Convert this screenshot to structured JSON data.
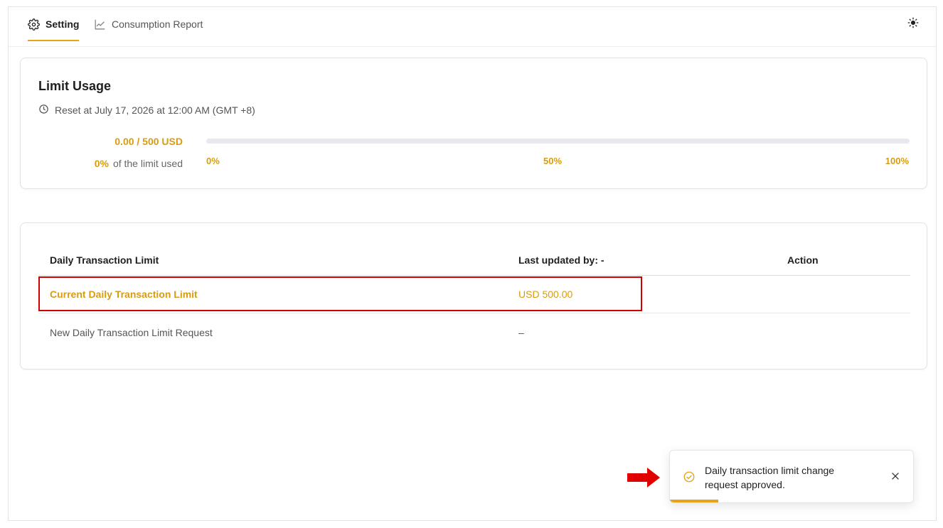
{
  "tabs": [
    {
      "label": "Setting",
      "icon": "gear-icon",
      "active": true
    },
    {
      "label": "Consumption Report",
      "icon": "line-chart-icon",
      "active": false
    }
  ],
  "header": {
    "theme_icon": "sun-icon"
  },
  "usage": {
    "title": "Limit Usage",
    "reset_text": "Reset at July 17, 2026 at 12:00 AM (GMT +8)",
    "amount_text": "0.00 / 500 USD",
    "percent_value": "0%",
    "percent_suffix": "of the limit used",
    "progress_fraction": 0,
    "ticks": [
      "0%",
      "50%",
      "100%"
    ]
  },
  "limits_table": {
    "headers": [
      "Daily Transaction Limit",
      "Last updated by: -",
      "Action"
    ],
    "rows": [
      {
        "label": "Current Daily Transaction Limit",
        "value": "USD 500.00",
        "action": ""
      },
      {
        "label": "New Daily Transaction Limit Request",
        "value": "–",
        "action": ""
      }
    ]
  },
  "toast": {
    "message": "Daily transaction limit change request approved.",
    "icon": "check-circle-icon",
    "close_icon": "close-icon",
    "progress_fraction": 0.2
  },
  "colors": {
    "accent": "#e8a317",
    "accent_text": "#d89c10",
    "annotation_red": "#d40000"
  }
}
